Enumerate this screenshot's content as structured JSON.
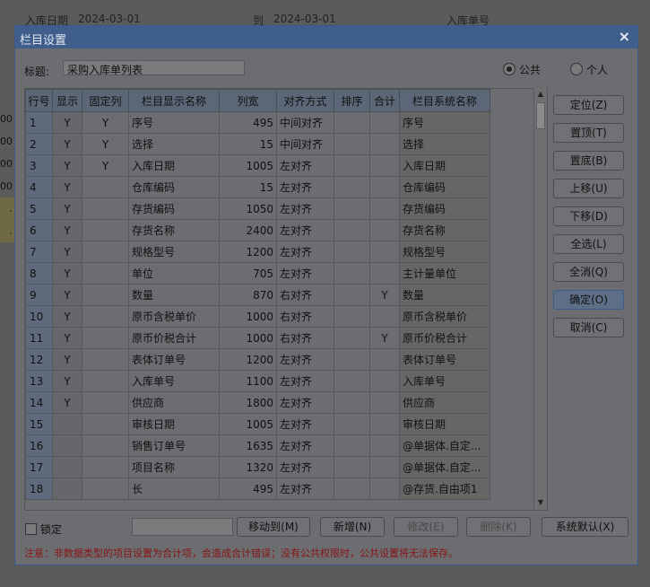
{
  "background": {
    "fields": [
      "入库日期",
      "2024-03-01",
      "到",
      "2024-03-01",
      "入库单号"
    ],
    "left_row_values": [
      "00",
      "00",
      "00",
      "00",
      ".",
      "."
    ]
  },
  "dialog": {
    "title": "栏目设置",
    "close_glyph": "×",
    "caption_label": "标题:",
    "caption_value": "采购入库单列表",
    "radio_public": "公共",
    "radio_private": "个人",
    "selected_scope": "公共"
  },
  "grid": {
    "headers": [
      "行号",
      "显示",
      "固定列",
      "栏目显示名称",
      "列宽",
      "对齐方式",
      "排序",
      "合计",
      "栏目系统名称"
    ],
    "rows": [
      [
        "1",
        "Y",
        "Y",
        "序号",
        "495",
        "中间对齐",
        "",
        "",
        "序号"
      ],
      [
        "2",
        "Y",
        "Y",
        "选择",
        "15",
        "中间对齐",
        "",
        "",
        "选择"
      ],
      [
        "3",
        "Y",
        "Y",
        "入库日期",
        "1005",
        "左对齐",
        "",
        "",
        "入库日期"
      ],
      [
        "4",
        "Y",
        "",
        "仓库编码",
        "15",
        "左对齐",
        "",
        "",
        "仓库编码"
      ],
      [
        "5",
        "Y",
        "",
        "存货编码",
        "1050",
        "左对齐",
        "",
        "",
        "存货编码"
      ],
      [
        "6",
        "Y",
        "",
        "存货名称",
        "2400",
        "左对齐",
        "",
        "",
        "存货名称"
      ],
      [
        "7",
        "Y",
        "",
        "规格型号",
        "1200",
        "左对齐",
        "",
        "",
        "规格型号"
      ],
      [
        "8",
        "Y",
        "",
        "单位",
        "705",
        "左对齐",
        "",
        "",
        "主计量单位"
      ],
      [
        "9",
        "Y",
        "",
        "数量",
        "870",
        "右对齐",
        "",
        "Y",
        "数量"
      ],
      [
        "10",
        "Y",
        "",
        "原币含税单价",
        "1000",
        "右对齐",
        "",
        "",
        "原币含税单价"
      ],
      [
        "11",
        "Y",
        "",
        "原币价税合计",
        "1000",
        "右对齐",
        "",
        "Y",
        "原币价税合计"
      ],
      [
        "12",
        "Y",
        "",
        "表体订单号",
        "1200",
        "左对齐",
        "",
        "",
        "表体订单号"
      ],
      [
        "13",
        "Y",
        "",
        "入库单号",
        "1100",
        "左对齐",
        "",
        "",
        "入库单号"
      ],
      [
        "14",
        "Y",
        "",
        "供应商",
        "1800",
        "左对齐",
        "",
        "",
        "供应商"
      ],
      [
        "15",
        "",
        "",
        "审核日期",
        "1005",
        "左对齐",
        "",
        "",
        "审核日期"
      ],
      [
        "16",
        "",
        "",
        "销售订单号",
        "1635",
        "左对齐",
        "",
        "",
        "@单据体.自定..."
      ],
      [
        "17",
        "",
        "",
        "项目名称",
        "1320",
        "左对齐",
        "",
        "",
        "@单据体.自定..."
      ],
      [
        "18",
        "",
        "",
        "长",
        "495",
        "左对齐",
        "",
        "",
        "@存货.自由项1"
      ]
    ]
  },
  "buttons": {
    "locate": "定位(Z)",
    "top": "置顶(T)",
    "bottom": "置底(B)",
    "up": "上移(U)",
    "down": "下移(D)",
    "select_all": "全选(L)",
    "clear_all": "全消(Q)",
    "ok": "确定(O)",
    "cancel": "取消(C)",
    "move_to": "移动到(M)",
    "add": "新增(N)",
    "edit": "修改(E)",
    "delete": "删除(K)",
    "system_default": "系统默认(X)"
  },
  "lock_label": "锁定",
  "warning": "注意：非数据类型的项目设置为合计项，会造成合计错误；没有公共权限时，公共设置将无法保存。",
  "colors": {
    "title_bar": "#3f5e8c",
    "warning_text": "#8a1414",
    "focused_button": "#5d6f86"
  }
}
